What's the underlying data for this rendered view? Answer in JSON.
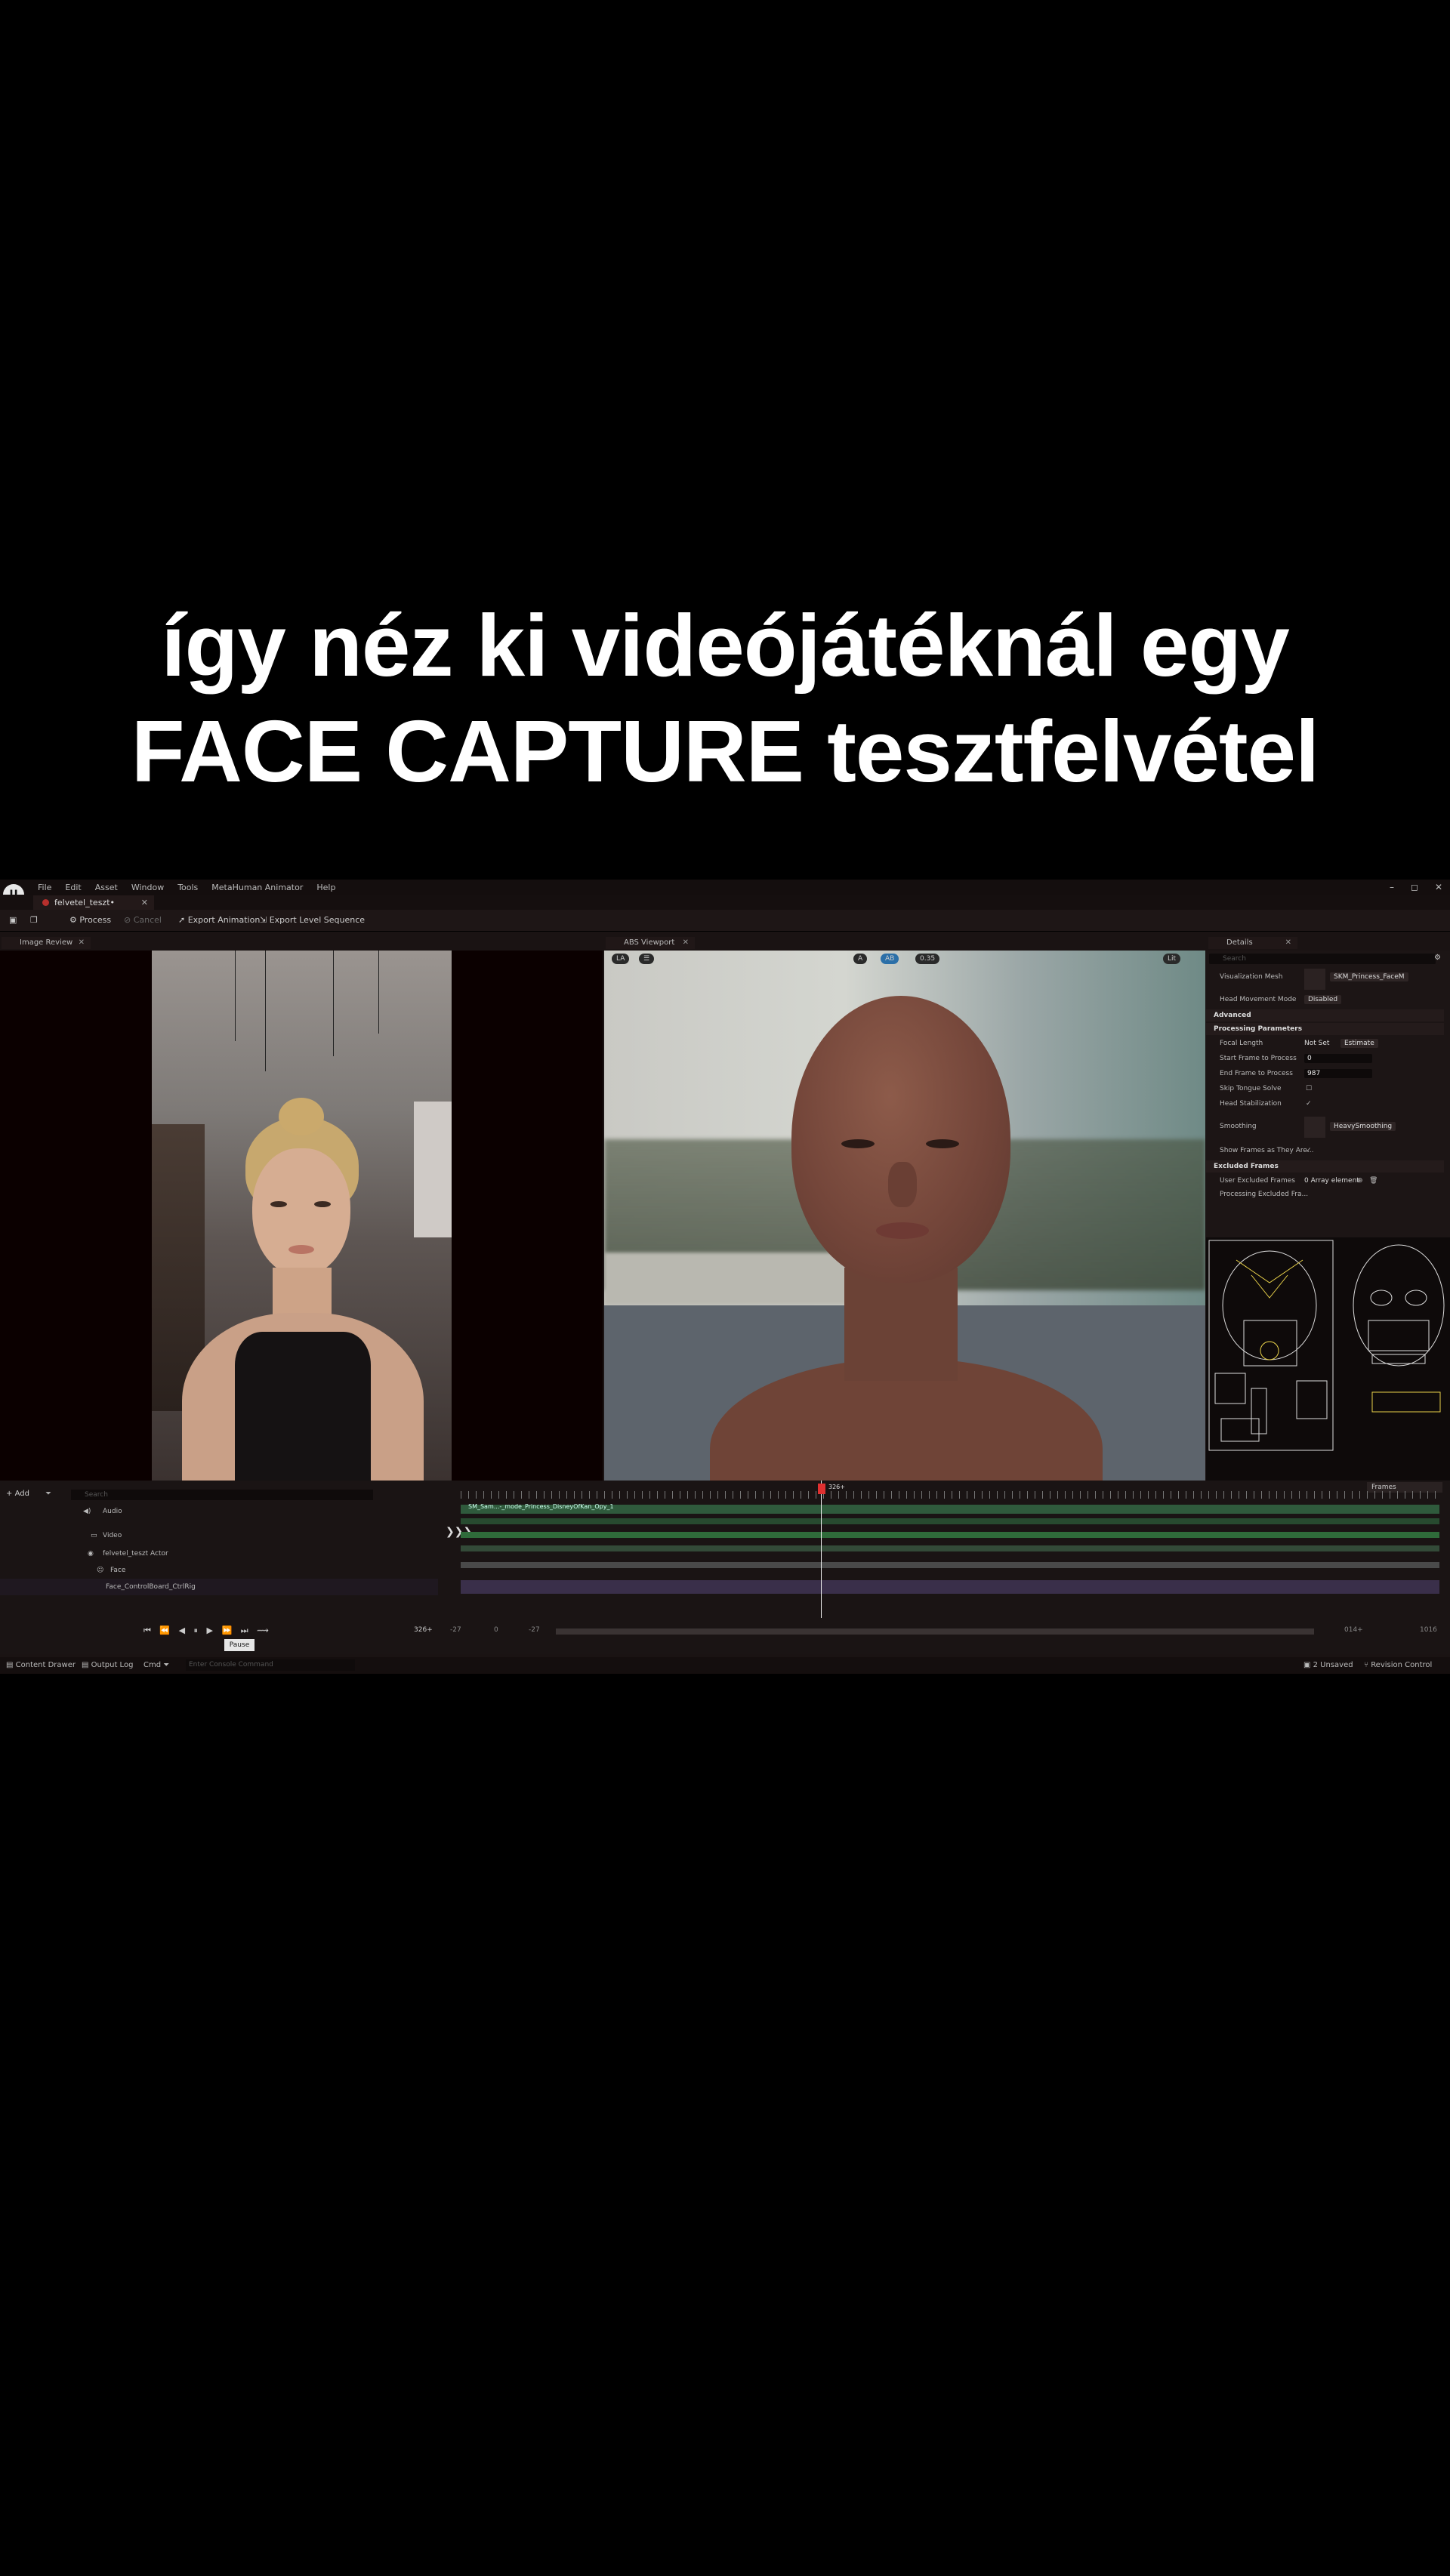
{
  "caption": {
    "line1": "így néz ki videójátéknál egy",
    "line2": "FACE CAPTURE tesztfelvétel"
  },
  "app": {
    "logo": "U",
    "menu": [
      "File",
      "Edit",
      "Asset",
      "Window",
      "Tools",
      "MetaHuman Animator",
      "Help"
    ],
    "window_controls": [
      "–",
      "◻",
      "✕"
    ],
    "doc_tab": "felvetel_teszt•",
    "doc_tab_close": "✕"
  },
  "toolbar": {
    "process": "Process",
    "cancel": "Cancel",
    "export_animation": "Export Animation",
    "export_level_sequence": "Export Level Sequence"
  },
  "panels": {
    "image_review": "Image Review",
    "abs_viewport": "ABS Viewport",
    "details": "Details",
    "close": "✕"
  },
  "viewport": {
    "buttons": [
      "LA",
      "A",
      "AB",
      "Lit"
    ],
    "zoom": "0.35"
  },
  "details": {
    "search_placeholder": "Search",
    "visualization_mesh_label": "Visualization Mesh",
    "visualization_mesh_value": "SKM_Princess_FaceM",
    "head_movement_label": "Head Movement Mode",
    "head_movement_value": "Disabled",
    "advanced": "Advanced",
    "processing_parameters": "Processing Parameters",
    "focal_length_label": "Focal Length",
    "focal_length_value": "Not Set",
    "estimate_button": "Estimate",
    "start_frame_label": "Start Frame to Process",
    "start_frame_value": "0",
    "end_frame_label": "End Frame to Process",
    "end_frame_value": "987",
    "skip_tongue_label": "Skip Tongue Solve",
    "head_stab_label": "Head Stabilization",
    "smoothing_label": "Smoothing",
    "smoothing_value": "HeavySmoothing",
    "show_frames_label": "Show Frames as They Are...",
    "excluded_frames": "Excluded Frames",
    "user_excluded_label": "User Excluded Frames",
    "user_excluded_value": "0 Array element",
    "processing_excluded_label": "Processing Excluded Fra..."
  },
  "sequencer": {
    "add": "Add",
    "search_placeholder": "Search",
    "frames_dropdown": "Frames",
    "tracks": [
      {
        "name": "Audio",
        "indent": 0
      },
      {
        "name": "Video",
        "indent": 0
      },
      {
        "name": "felvetel_teszt Actor",
        "indent": 0
      },
      {
        "name": "Face",
        "indent": 1
      },
      {
        "name": "Face_ControlBoard_CtrlRig",
        "indent": 2
      }
    ],
    "clip_label": "SM_Sam...-_mode_Princess_DisneyOfKan_Opy_1",
    "playhead_frame": "326+",
    "current_frame": "326+",
    "range_start": "-27",
    "range_mid": "0",
    "range_mid2": "-27",
    "range_end": "014+",
    "range_end2": "1016",
    "tooltip": "Pause"
  },
  "statusbar": {
    "content_drawer": "Content Drawer",
    "output_log": "Output Log",
    "cmd": "Cmd",
    "console_placeholder": "Enter Console Command",
    "unsaved": "2 Unsaved",
    "revision_control": "Revision Control"
  },
  "colors": {
    "accent": "#b8302d",
    "lane_green": "#2f6b3a",
    "lane_purple": "#3a2f4a",
    "highlight_yellow": "#e9d24a"
  }
}
